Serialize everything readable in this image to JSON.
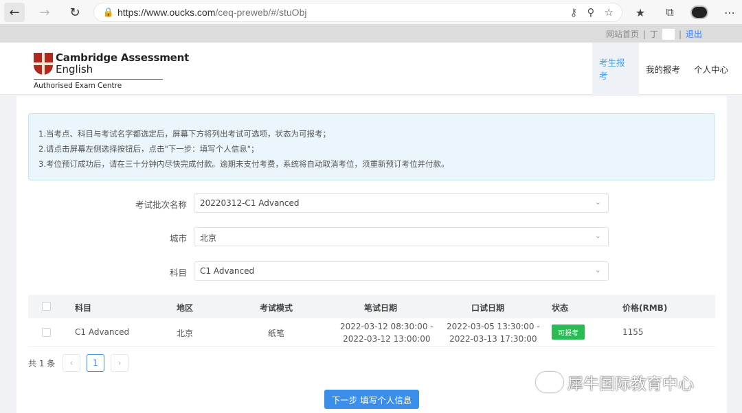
{
  "browser": {
    "url_host": "https://www.oucks.com",
    "url_path": "/ceq-preweb/#/stuObj"
  },
  "top_links": {
    "home": "网站首页",
    "separator": "|",
    "user": "丁",
    "logout": "退出"
  },
  "logo": {
    "line1": "Cambridge Assessment",
    "line2": "English",
    "line3": "Authorised Exam Centre"
  },
  "nav": {
    "items": [
      "考生报考",
      "我的报考",
      "个人中心"
    ],
    "active_index": 0
  },
  "notice": {
    "lines": [
      "1.当考点、科目与考试名字都选定后，屏幕下方将列出考试可选项，状态为可报考；",
      "2.请点击屏幕左侧选择按钮后，点击\"下一步：填写个人信息\"；",
      "3.考位预订成功后，请在三十分钟内尽快完成付款。逾期未支付考费，系统将自动取消考位，须重新预订考位并付款。"
    ]
  },
  "form": {
    "exam_batch": {
      "label": "考试批次名称",
      "value": "20220312-C1 Advanced"
    },
    "city": {
      "label": "城市",
      "value": "北京"
    },
    "subject": {
      "label": "科目",
      "value": "C1 Advanced"
    }
  },
  "table": {
    "headers": [
      "科目",
      "地区",
      "考试模式",
      "笔试日期",
      "口试日期",
      "状态",
      "价格(RMB)"
    ],
    "rows": [
      {
        "subject": "C1 Advanced",
        "region": "北京",
        "mode": "纸笔",
        "written_start": "2022-03-12 08:30:00 -",
        "written_end": "2022-03-12 13:00:00",
        "oral_start": "2022-03-05 13:30:00 -",
        "oral_end": "2022-03-13 17:30:00",
        "status": "可报考",
        "price": "1155"
      }
    ]
  },
  "pagination": {
    "total": "共 1 条",
    "current_page": "1"
  },
  "next_button": "下一步 填写个人信息",
  "watermark": "犀牛国际教育中心",
  "colors": {
    "accent": "#3b8eea",
    "status_green": "#2bbb55",
    "nav_active": "#4aa1e8"
  }
}
